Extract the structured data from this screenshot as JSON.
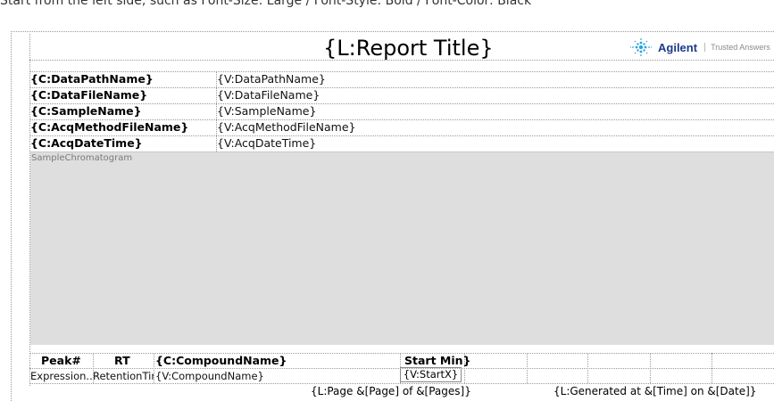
{
  "top_strip_text": "Start from the left side, such as Font-Size: Large / Font-Style: Bold / Font-Color: Black",
  "header": {
    "title": "{L:Report Title}",
    "logo_name": "Agilent",
    "logo_tagline": "Trusted Answers"
  },
  "meta_rows": [
    {
      "label": "{C:DataPathName}",
      "value": "{V:DataPathName}"
    },
    {
      "label": "{C:DataFileName}",
      "value": "{V:DataFileName}"
    },
    {
      "label": "{C:SampleName}",
      "value": "{V:SampleName}"
    },
    {
      "label": "{C:AcqMethodFileName}",
      "value": "{V:AcqMethodFileName}"
    },
    {
      "label": "{C:AcqDateTime}",
      "value": "{V:AcqDateTime}"
    }
  ],
  "chromatogram": {
    "label": "SampleChromatogram"
  },
  "table": {
    "headers": {
      "peak": "Peak#",
      "rt": "RT",
      "compound": "{C:CompoundName}",
      "start_min": "Start Min}"
    },
    "row": {
      "peak": "Expression...",
      "rt": "RetentionTir",
      "compound": "{V:CompoundName}",
      "start_x": "{V:StartX}"
    }
  },
  "footer": {
    "page": "{L:Page &[Page] of &[Pages]}",
    "generated": "{L:Generated at &[Time] on &[Date]}"
  },
  "colors": {
    "chromatogram_bg": "#dedede",
    "logo_blue": "#1a3b8a"
  }
}
